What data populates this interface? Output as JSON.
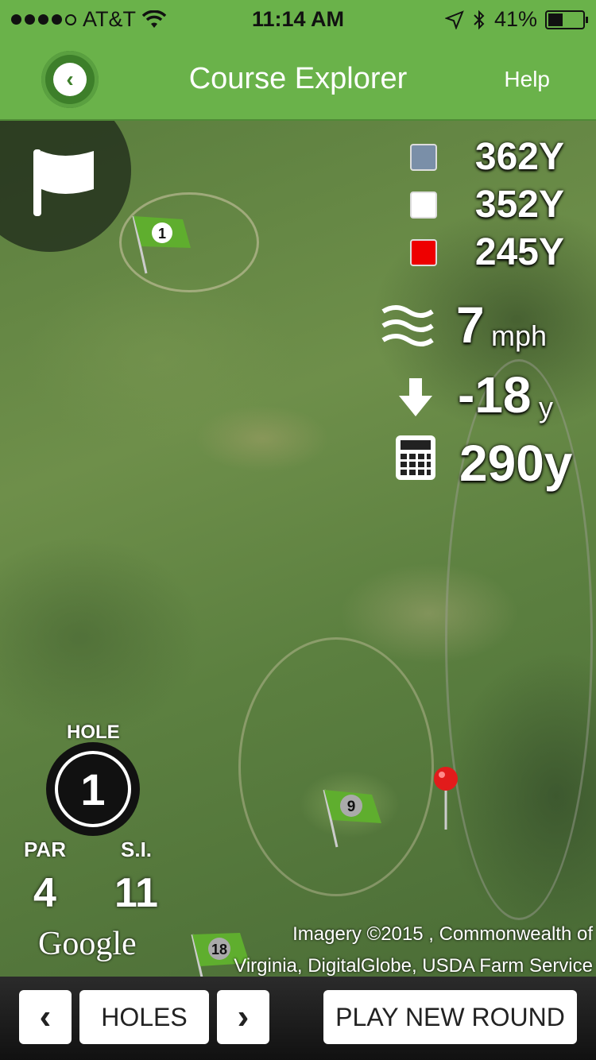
{
  "status": {
    "carrier": "AT&T",
    "time": "11:14 AM",
    "battery": "41%"
  },
  "header": {
    "title": "Course Explorer",
    "help_label": "Help"
  },
  "tees": [
    {
      "color": "#7a8fa8",
      "yards": "362Y"
    },
    {
      "color": "#ffffff",
      "yards": "352Y"
    },
    {
      "color": "#ee0000",
      "yards": "245Y"
    }
  ],
  "wind": {
    "value": "7",
    "unit": "mph"
  },
  "elevation": {
    "value": "-18",
    "unit": "y"
  },
  "plays_like": {
    "value": "290y"
  },
  "hole": {
    "label": "HOLE",
    "number": "1",
    "par_label": "PAR",
    "par": "4",
    "si_label": "S.I.",
    "si": "11"
  },
  "map_flags": {
    "flag1": "1",
    "flag9": "9",
    "flag18": "18"
  },
  "map_credit": {
    "logo": "Google",
    "line1": "Imagery ©2015 , Commonwealth of",
    "line2": "Virginia, DigitalGlobe, USDA Farm Service"
  },
  "bottom": {
    "prev": "‹",
    "holes": "HOLES",
    "next": "›",
    "new_round": "PLAY NEW ROUND"
  }
}
